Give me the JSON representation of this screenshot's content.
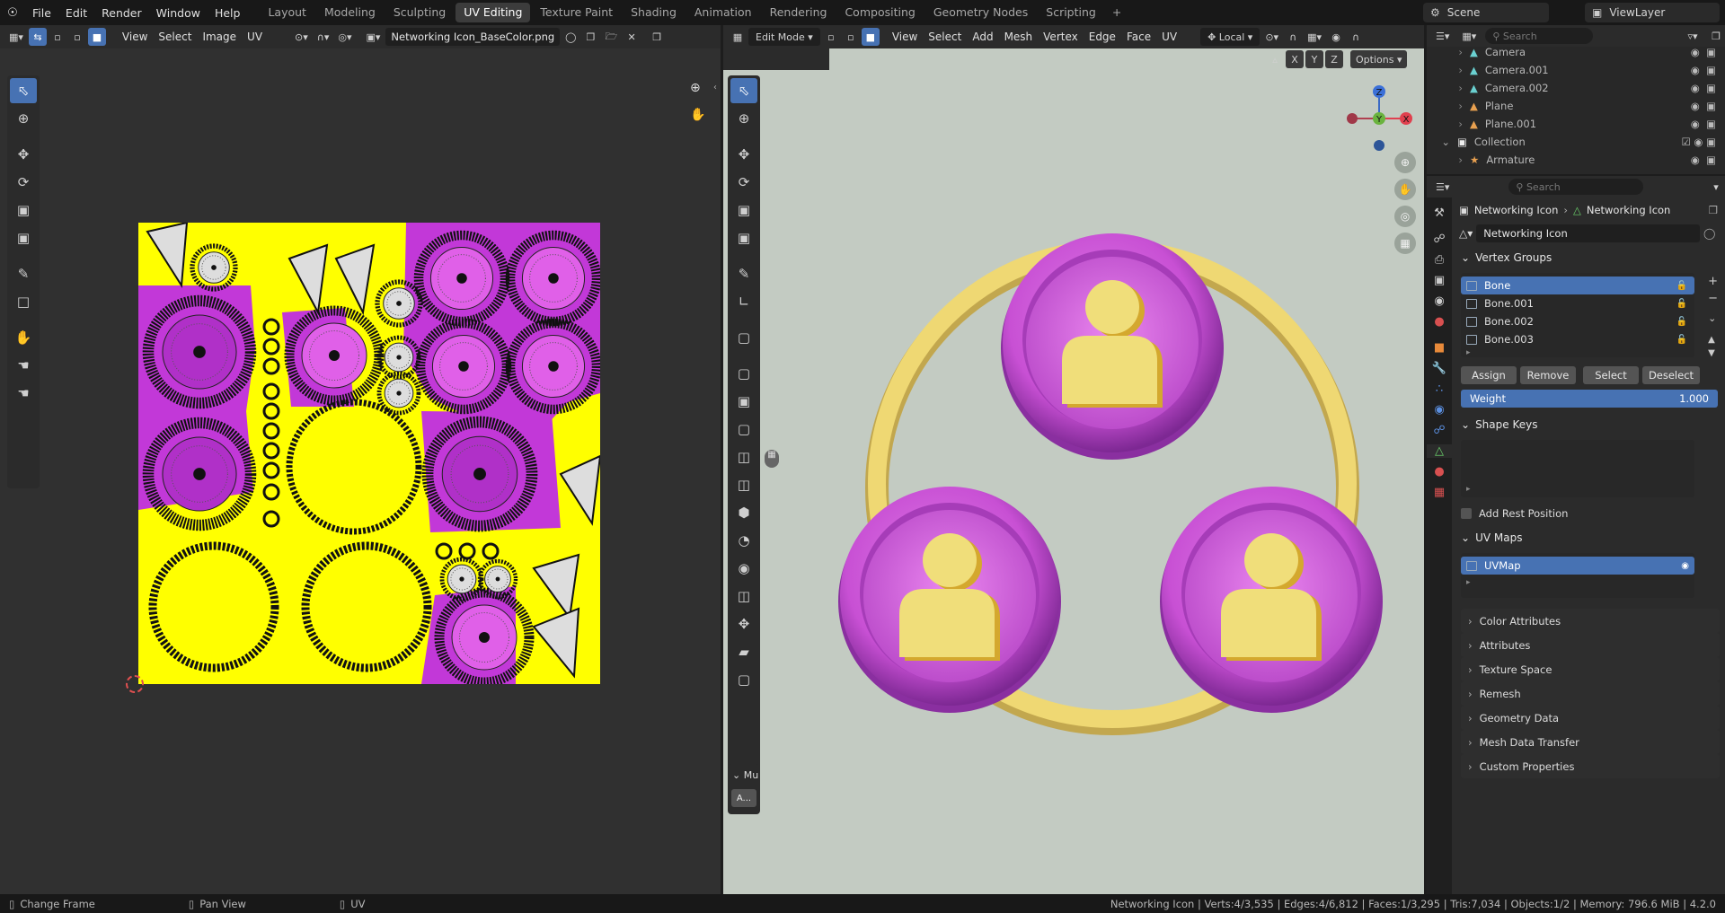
{
  "menus": [
    "File",
    "Edit",
    "Render",
    "Window",
    "Help"
  ],
  "workspaces": [
    "Layout",
    "Modeling",
    "Sculpting",
    "UV Editing",
    "Texture Paint",
    "Shading",
    "Animation",
    "Rendering",
    "Compositing",
    "Geometry Nodes",
    "Scripting"
  ],
  "add_tab": "+",
  "scene": "Scene",
  "view_layer": "ViewLayer",
  "uv_editor": {
    "menus": [
      "View",
      "Select",
      "Image",
      "UV"
    ],
    "image_name": "Networking Icon_BaseColor.png"
  },
  "viewport": {
    "mode": "Edit Mode",
    "menus": [
      "View",
      "Select",
      "Add",
      "Mesh",
      "Vertex",
      "Edge",
      "Face",
      "UV"
    ],
    "orientation": "Local",
    "axes": [
      "X",
      "Y",
      "Z"
    ],
    "options": "Options",
    "gizmo": {
      "z": "Z",
      "y": "Y",
      "x": "X"
    },
    "collapsed_label": "Mu",
    "small_btn": "A..."
  },
  "outliner": {
    "search_placeholder": "Search",
    "items": [
      "Camera",
      "Camera.001",
      "Camera.002",
      "Plane",
      "Plane.001"
    ],
    "collection": "Collection",
    "armature": "Armature"
  },
  "properties": {
    "search_placeholder": "Search",
    "breadcrumb_object": "Networking Icon",
    "breadcrumb_data": "Networking Icon",
    "data_name": "Networking Icon",
    "vertex_groups_title": "Vertex Groups",
    "vertex_groups": [
      "Bone",
      "Bone.001",
      "Bone.002",
      "Bone.003"
    ],
    "assign": "Assign",
    "remove": "Remove",
    "select": "Select",
    "deselect": "Deselect",
    "weight_label": "Weight",
    "weight_value": "1.000",
    "shape_keys_title": "Shape Keys",
    "add_rest_position": "Add Rest Position",
    "uv_maps_title": "UV Maps",
    "uv_map": "UVMap",
    "collapsed": [
      "Color Attributes",
      "Attributes",
      "Texture Space",
      "Remesh",
      "Geometry Data",
      "Mesh Data Transfer",
      "Custom Properties"
    ]
  },
  "status": {
    "change_frame": "Change Frame",
    "pan_view": "Pan View",
    "uv": "UV",
    "stats": "Networking Icon | Verts:4/3,535 | Edges:4/6,812 | Faces:1/3,295 | Tris:7,034 | Objects:1/2 | Memory: 796.6 MiB | 4.2.0"
  },
  "colors": {
    "accent": "#4772b3",
    "texture_yellow": "#ffff00",
    "texture_magenta": "#c040d8",
    "viewport_bg": "#c3cbc2",
    "ring_yellow": "#efd873",
    "disc_magenta": "#c95ad6"
  }
}
